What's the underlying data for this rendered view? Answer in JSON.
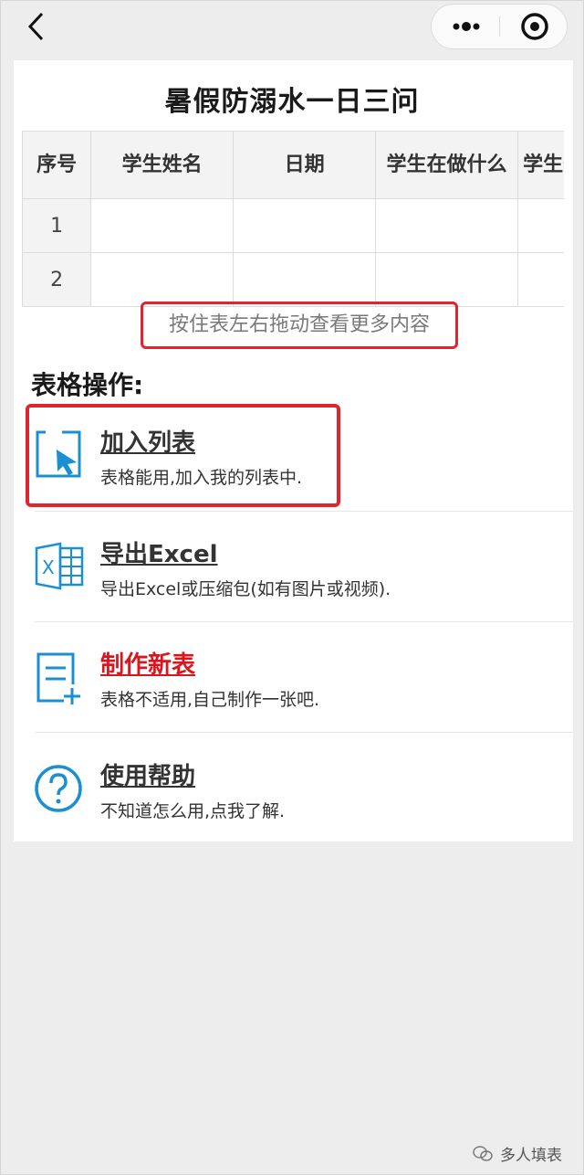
{
  "colors": {
    "accent": "#1a8fd1",
    "highlight": "#e0262c",
    "danger_link": "#d9161e"
  },
  "nav": {
    "back_icon": "chevron-left-icon",
    "more_icon": "more-dots-icon",
    "close_icon": "target-circle-icon"
  },
  "page": {
    "title": "暑假防溺水一日三问"
  },
  "table": {
    "headers": [
      "序号",
      "学生姓名",
      "日期",
      "学生在做什么",
      "学生去哪儿了?"
    ],
    "rows": [
      [
        "1",
        "",
        "",
        "",
        ""
      ],
      [
        "2",
        "",
        "",
        "",
        ""
      ]
    ],
    "hint": "按住表左右拖动查看更多内容"
  },
  "operations": {
    "title": "表格操作:",
    "items": [
      {
        "name": "加入列表",
        "desc": "表格能用,加入我的列表中.",
        "icon": "cursor-box-icon"
      },
      {
        "name": "导出Excel",
        "desc": "导出Excel或压缩包(如有图片或视频).",
        "icon": "excel-icon"
      },
      {
        "name": "制作新表",
        "desc": "表格不适用,自己制作一张吧.",
        "icon": "new-sheet-icon"
      },
      {
        "name": "使用帮助",
        "desc": "不知道怎么用,点我了解.",
        "icon": "help-icon"
      }
    ]
  },
  "watermark": {
    "text": "多人填表"
  }
}
